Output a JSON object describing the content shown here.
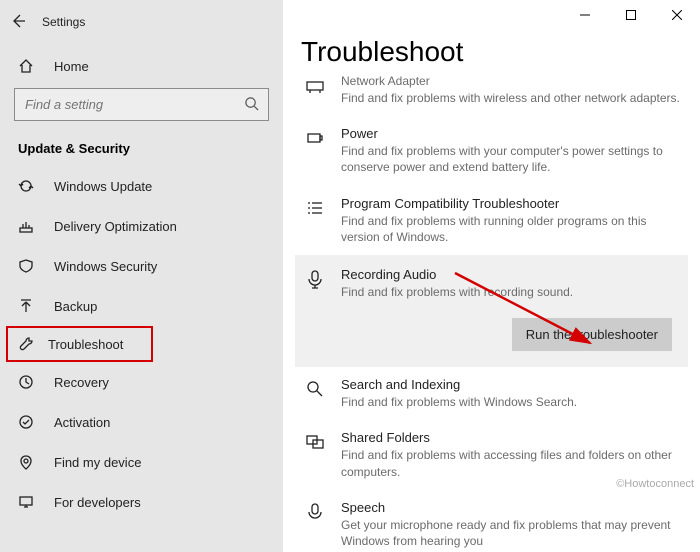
{
  "window": {
    "title": "Settings"
  },
  "sidebar": {
    "home": "Home",
    "search_placeholder": "Find a setting",
    "section": "Update & Security",
    "items": [
      {
        "label": "Windows Update"
      },
      {
        "label": "Delivery Optimization"
      },
      {
        "label": "Windows Security"
      },
      {
        "label": "Backup"
      },
      {
        "label": "Troubleshoot"
      },
      {
        "label": "Recovery"
      },
      {
        "label": "Activation"
      },
      {
        "label": "Find my device"
      },
      {
        "label": "For developers"
      }
    ]
  },
  "main": {
    "title": "Troubleshoot",
    "items": [
      {
        "title": "Network Adapter",
        "desc": "Find and fix problems with wireless and other network adapters."
      },
      {
        "title": "Power",
        "desc": "Find and fix problems with your computer's power settings to conserve power and extend battery life."
      },
      {
        "title": "Program Compatibility Troubleshooter",
        "desc": "Find and fix problems with running older programs on this version of Windows."
      },
      {
        "title": "Recording Audio",
        "desc": "Find and fix problems with recording sound."
      },
      {
        "title": "Search and Indexing",
        "desc": "Find and fix problems with Windows Search."
      },
      {
        "title": "Shared Folders",
        "desc": "Find and fix problems with accessing files and folders on other computers."
      },
      {
        "title": "Speech",
        "desc": "Get your microphone ready and fix problems that may prevent Windows from hearing you"
      }
    ],
    "run_button": "Run the troubleshooter"
  },
  "watermark": "©Howtoconnect"
}
